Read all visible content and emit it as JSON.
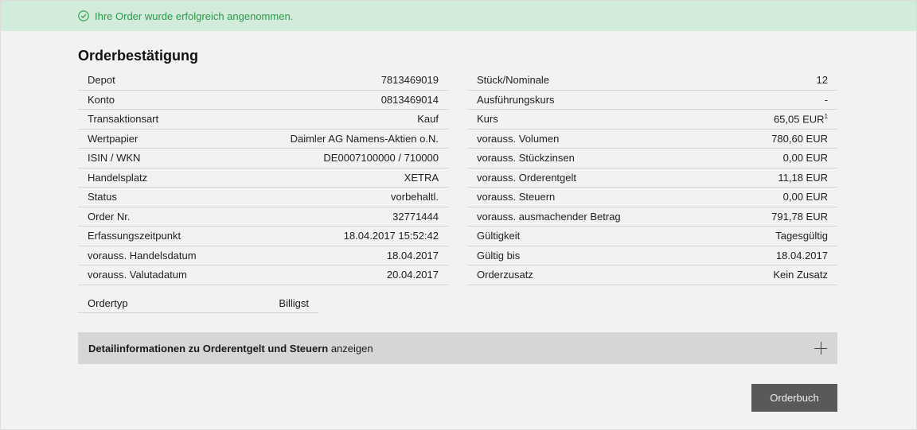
{
  "banner": {
    "message": "Ihre Order wurde erfolgreich angenommen.",
    "icon": "check-circle-icon",
    "color": "#2a9a4a",
    "background": "#d3ebdb"
  },
  "title": "Orderbestätigung",
  "left_details": [
    {
      "label": "Depot",
      "value": "7813469019"
    },
    {
      "label": "Konto",
      "value": "0813469014"
    },
    {
      "label": "Transaktionsart",
      "value": "Kauf"
    },
    {
      "label": "Wertpapier",
      "value": "Daimler AG Namens-Aktien o.N."
    },
    {
      "label": "ISIN / WKN",
      "value": "DE0007100000 / 710000"
    },
    {
      "label": "Handelsplatz",
      "value": "XETRA"
    },
    {
      "label": "Status",
      "value": "vorbehaltl."
    },
    {
      "label": "Order Nr.",
      "value": "32771444"
    },
    {
      "label": "Erfassungszeitpunkt",
      "value": "18.04.2017 15:52:42"
    },
    {
      "label": "vorauss. Handelsdatum",
      "value": "18.04.2017"
    },
    {
      "label": "vorauss. Valutadatum",
      "value": "20.04.2017"
    }
  ],
  "right_details": [
    {
      "label": "Stück/Nominale",
      "value": "12"
    },
    {
      "label": "Ausführungskurs",
      "value": "-"
    },
    {
      "label": "Kurs",
      "value": "65,05 EUR",
      "footnote": "1"
    },
    {
      "label": "vorauss. Volumen",
      "value": "780,60 EUR"
    },
    {
      "label": "vorauss. Stückzinsen",
      "value": "0,00 EUR"
    },
    {
      "label": "vorauss. Orderentgelt",
      "value": "11,18 EUR"
    },
    {
      "label": "vorauss. Steuern",
      "value": "0,00 EUR"
    },
    {
      "label": "vorauss. ausmachender Betrag",
      "value": "791,78 EUR"
    },
    {
      "label": "Gültigkeit",
      "value": "Tagesgültig"
    },
    {
      "label": "Gültig bis",
      "value": "18.04.2017"
    },
    {
      "label": "Orderzusatz",
      "value": "Kein Zusatz"
    }
  ],
  "ordertyp": {
    "label": "Ordertyp",
    "value": "Billigst"
  },
  "detail_toggle": {
    "bold_text": "Detailinformationen zu Orderentgelt und Steuern",
    "text": " anzeigen",
    "icon": "plus-icon"
  },
  "orderbuch_button": "Orderbuch"
}
